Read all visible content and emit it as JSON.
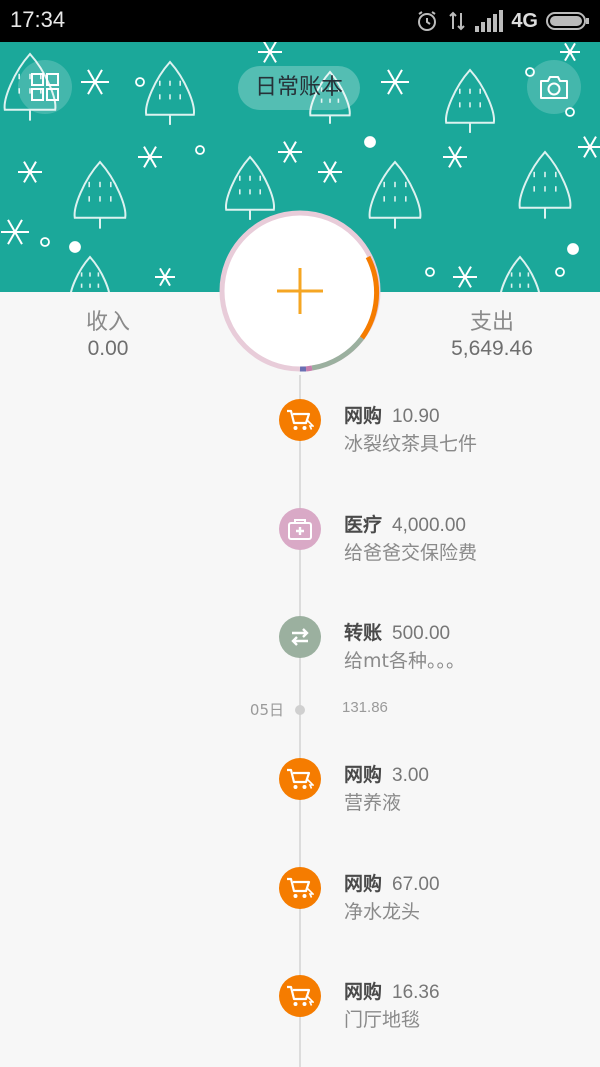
{
  "status_bar": {
    "time": "17:34",
    "network": "4G"
  },
  "header": {
    "book_title": "日常账本",
    "menu_icon": "grid-icon",
    "camera_icon": "camera-icon",
    "banner_color": "#1ba89a"
  },
  "summary": {
    "income_label": "收入",
    "income_value": "0.00",
    "expense_label": "支出",
    "expense_value": "5,649.46"
  },
  "add_button": {
    "icon": "plus-icon",
    "accent": "#f5a623"
  },
  "entries": [
    {
      "category": "网购",
      "amount": "10.90",
      "note": "冰裂纹茶具七件",
      "icon": "cart-icon",
      "color": "#f57c00"
    },
    {
      "category": "医疗",
      "amount": "4,000.00",
      "note": "给爸爸交保险费",
      "icon": "medical-kit-icon",
      "color": "#d9a9c6"
    },
    {
      "category": "转账",
      "amount": "500.00",
      "note": "给mt各种。。。",
      "icon": "transfer-icon",
      "color": "#9bb09f"
    },
    {
      "category": "网购",
      "amount": "3.00",
      "note": "营养液",
      "icon": "cart-icon",
      "color": "#f57c00"
    },
    {
      "category": "网购",
      "amount": "67.00",
      "note": "净水龙头",
      "icon": "cart-icon",
      "color": "#f57c00"
    },
    {
      "category": "网购",
      "amount": "16.36",
      "note": "门厅地毯",
      "icon": "cart-icon",
      "color": "#f57c00"
    }
  ],
  "day_separator": {
    "date": "05日",
    "total": "131.86"
  }
}
